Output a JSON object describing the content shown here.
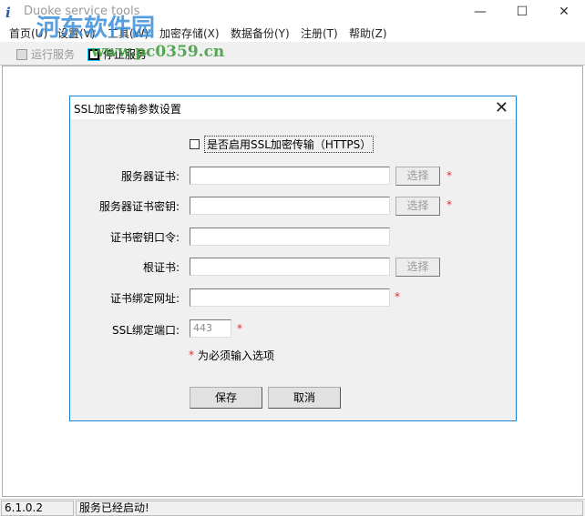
{
  "window": {
    "title": "Duoke service tools",
    "minimize": "—",
    "maximize": "☐",
    "close": "✕"
  },
  "watermark": {
    "name": "河东软件园",
    "url": "www.pc0359.cn"
  },
  "menu": [
    "首页(U)",
    "设置(V)",
    "工具(W)",
    "加密存储(X)",
    "数据备份(Y)",
    "注册(T)",
    "帮助(Z)"
  ],
  "toolbar": {
    "run": "运行服务",
    "stop": "停止服务"
  },
  "dialog": {
    "title": "SSL加密传输参数设置",
    "close": "✕",
    "enable_ssl": "是否启用SSL加密传输（HTTPS）",
    "enable_ssl_checked": false,
    "fields": [
      {
        "label": "服务器证书:",
        "value": "",
        "choose": "选择",
        "required": true
      },
      {
        "label": "服务器证书密钥:",
        "value": "",
        "choose": "选择",
        "required": true
      },
      {
        "label": "证书密钥口令:",
        "value": ""
      },
      {
        "label": "根证书:",
        "value": "",
        "choose": "选择"
      },
      {
        "label": "证书绑定网址:",
        "value": "",
        "required": true
      },
      {
        "label": "SSL绑定端口:",
        "value": "443",
        "required": true
      }
    ],
    "asterisk": "*",
    "required_note": "为必须输入选项",
    "save": "保存",
    "cancel": "取消"
  },
  "status": {
    "version": "6.1.0.2",
    "message": "服务已经启动!"
  }
}
